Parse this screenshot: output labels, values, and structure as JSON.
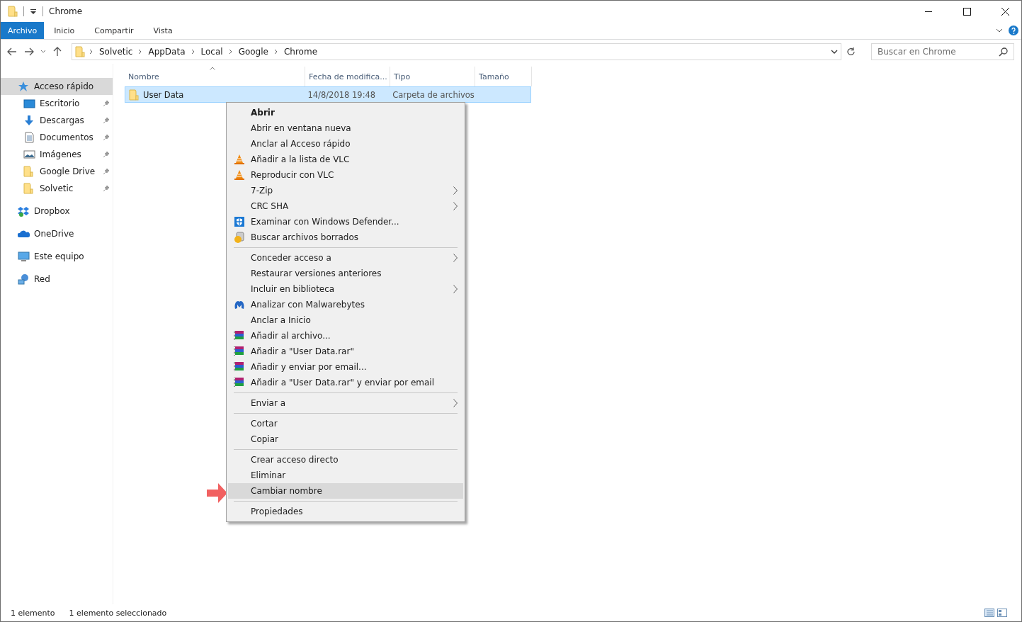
{
  "window": {
    "title": "Chrome"
  },
  "ribbon_tabs": [
    {
      "label": "Archivo",
      "selected": true
    },
    {
      "label": "Inicio",
      "selected": false
    },
    {
      "label": "Compartir",
      "selected": false
    },
    {
      "label": "Vista",
      "selected": false
    }
  ],
  "address_bar": {
    "path": [
      "Solvetic",
      "AppData",
      "Local",
      "Google",
      "Chrome"
    ]
  },
  "search": {
    "placeholder": "Buscar en Chrome"
  },
  "sidebar": {
    "items": [
      {
        "label": "Acceso rápido",
        "kind": "star",
        "selected": true,
        "pinned": false,
        "children": [
          {
            "label": "Escritorio",
            "kind": "desktop",
            "selected": false,
            "pinned": true
          },
          {
            "label": "Descargas",
            "kind": "download",
            "selected": false,
            "pinned": true
          },
          {
            "label": "Documentos",
            "kind": "document",
            "selected": false,
            "pinned": true
          },
          {
            "label": "Imágenes",
            "kind": "image",
            "selected": false,
            "pinned": true
          },
          {
            "label": "Google Drive",
            "kind": "folder",
            "selected": false,
            "pinned": true
          },
          {
            "label": "Solvetic",
            "kind": "folder",
            "selected": false,
            "pinned": true
          }
        ]
      },
      {
        "label": "Dropbox",
        "kind": "dropbox",
        "selected": false,
        "pinned": false
      },
      {
        "label": "OneDrive",
        "kind": "cloud",
        "selected": false,
        "pinned": false
      },
      {
        "label": "Este equipo",
        "kind": "computer",
        "selected": false,
        "pinned": false
      },
      {
        "label": "Red",
        "kind": "network",
        "selected": false,
        "pinned": false
      }
    ]
  },
  "table": {
    "columns": [
      {
        "label": "Nombre",
        "sorted": true
      },
      {
        "label": "Fecha de modifica...",
        "sorted": false
      },
      {
        "label": "Tipo",
        "sorted": false
      },
      {
        "label": "Tamaño",
        "sorted": false
      }
    ],
    "rows": [
      {
        "cells": [
          "User Data",
          "14/8/2018 19:48",
          "Carpeta de archivos",
          ""
        ],
        "selected": true
      }
    ]
  },
  "context_menu": {
    "groups": [
      [
        {
          "label": "Abrir",
          "default": true
        },
        {
          "label": "Abrir en ventana nueva"
        },
        {
          "label": "Anclar al Acceso rápido"
        },
        {
          "label": "Añadir a la lista de VLC",
          "kind": "cone"
        },
        {
          "label": "Reproducir con VLC",
          "kind": "cone"
        },
        {
          "label": "7-Zip",
          "submenu": true
        },
        {
          "label": "CRC SHA",
          "submenu": true
        },
        {
          "label": "Examinar con Windows Defender...",
          "kind": "shield"
        },
        {
          "label": "Buscar archivos borrados",
          "kind": "disk"
        }
      ],
      [
        {
          "label": "Conceder acceso a",
          "submenu": true
        },
        {
          "label": "Restaurar versiones anteriores"
        },
        {
          "label": "Incluir en biblioteca",
          "submenu": true
        },
        {
          "label": "Analizar con Malwarebytes",
          "kind": "m"
        },
        {
          "label": "Anclar a Inicio"
        },
        {
          "label": "Añadir al archivo...",
          "kind": "books"
        },
        {
          "label": "Añadir a \"User Data.rar\"",
          "kind": "books"
        },
        {
          "label": "Añadir y enviar por email...",
          "kind": "books"
        },
        {
          "label": "Añadir a \"User Data.rar\" y enviar por email",
          "kind": "books"
        }
      ],
      [
        {
          "label": "Enviar a",
          "submenu": true
        }
      ],
      [
        {
          "label": "Cortar"
        },
        {
          "label": "Copiar"
        }
      ],
      [
        {
          "label": "Crear acceso directo"
        },
        {
          "label": "Eliminar"
        },
        {
          "label": "Cambiar nombre",
          "highlighted": true,
          "pointed": true
        }
      ],
      [
        {
          "label": "Propiedades"
        }
      ]
    ]
  },
  "status_bar": {
    "item_count": "1 elemento",
    "selection": "1 elemento seleccionado"
  }
}
